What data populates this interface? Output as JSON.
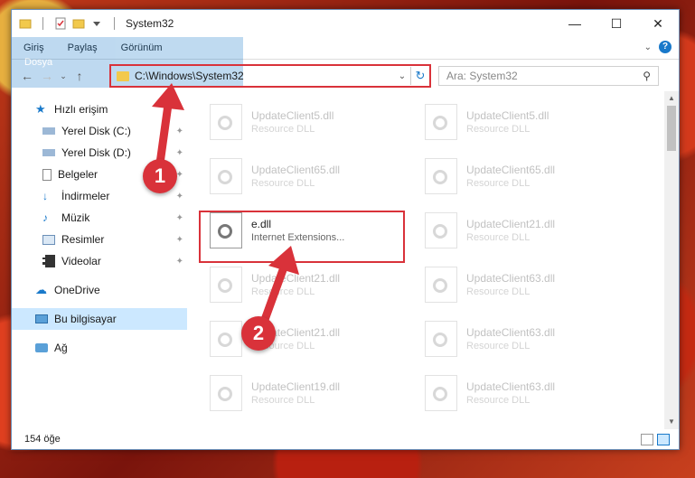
{
  "window": {
    "title": "System32",
    "controls": {
      "minimize": "—",
      "maximize": "☐",
      "close": "✕"
    }
  },
  "ribbon": {
    "tabs": [
      "Dosya",
      "Giriş",
      "Paylaş",
      "Görünüm"
    ]
  },
  "address_bar": {
    "path": "C:\\Windows\\System32",
    "search_placeholder": "Ara: System32"
  },
  "sidebar": {
    "quick_access": "Hızlı erişim",
    "items": [
      "Yerel Disk (C:)",
      "Yerel Disk (D:)",
      "Belgeler",
      "İndirmeler",
      "Müzik",
      "Resimler",
      "Videolar"
    ],
    "onedrive": "OneDrive",
    "this_pc": "Bu bilgisayar",
    "network": "Ağ"
  },
  "files": [
    {
      "name": "UpdateClient5.dll",
      "type": "Resource DLL"
    },
    {
      "name": "UpdateClient5.dll",
      "type": "Resource DLL"
    },
    {
      "name": "UpdateClient65.dll",
      "type": "Resource DLL"
    },
    {
      "name": "UpdateClient65.dll",
      "type": "Resource DLL"
    },
    {
      "name": "e.dll",
      "type": "Internet Extensions..."
    },
    {
      "name": "UpdateClient21.dll",
      "type": "Resource DLL"
    },
    {
      "name": "UpdateClient21.dll",
      "type": "Resource DLL"
    },
    {
      "name": "UpdateClient63.dll",
      "type": "Resource DLL"
    },
    {
      "name": "UpdateClient21.dll",
      "type": "Resource DLL"
    },
    {
      "name": "UpdateClient63.dll",
      "type": "Resource DLL"
    },
    {
      "name": "UpdateClient19.dll",
      "type": "Resource DLL"
    },
    {
      "name": "UpdateClient63.dll",
      "type": "Resource DLL"
    }
  ],
  "status": {
    "item_count": "154 öğe"
  },
  "annotations": {
    "step1": "1",
    "step2": "2",
    "color": "#d9323a"
  }
}
